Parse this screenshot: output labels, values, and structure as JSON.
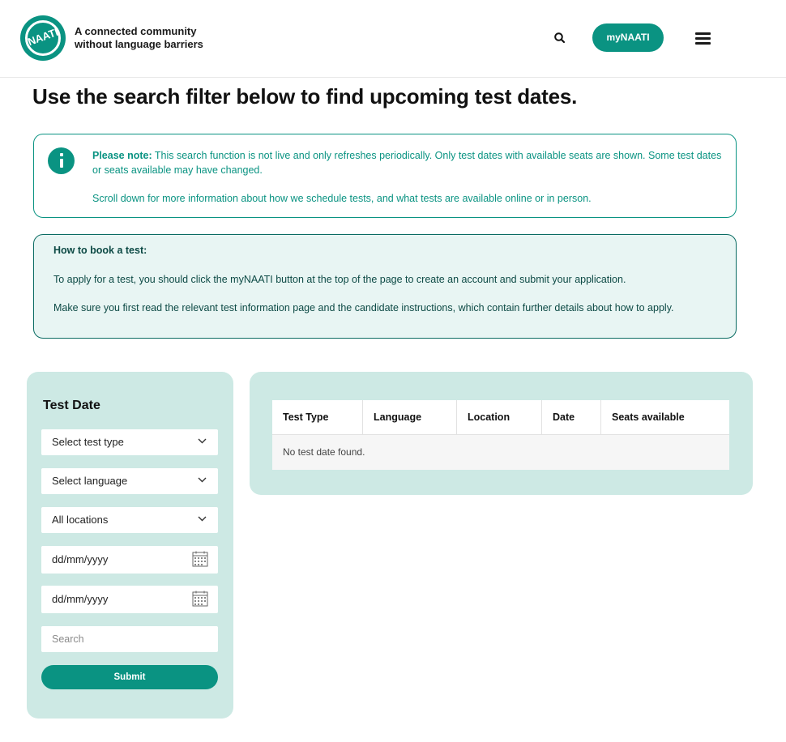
{
  "header": {
    "logo_text": "NAATI",
    "tagline_line1": "A connected community",
    "tagline_line2": "without language barriers",
    "mynaati_label": "myNAATI"
  },
  "page": {
    "title": "Use the search filter below to find upcoming test dates."
  },
  "note": {
    "label": "Please note:",
    "text": " This search function is not live and only refreshes periodically. Only test dates with available seats are shown. Some test dates or seats available may have changed.",
    "text2": "Scroll down for more information about how we schedule tests, and what tests are available online or in person."
  },
  "booking": {
    "title": "How to book a test:",
    "para1": "To apply for a test, you should click the myNAATI button at the top of the page to create an account and submit your application.",
    "para2": "Make sure you first read the relevant test information page and the candidate instructions, which contain further details about how to apply."
  },
  "filter": {
    "title": "Test Date",
    "test_type": "Select test type",
    "language": "Select language",
    "location": "All locations",
    "date_from": "dd/mm/yyyy",
    "date_to": "dd/mm/yyyy",
    "search_placeholder": "Search",
    "submit_label": "Submit"
  },
  "results": {
    "columns": [
      "Test Type",
      "Language",
      "Location",
      "Date",
      "Seats available"
    ],
    "empty_message": "No test date found."
  },
  "colors": {
    "brand": "#0a9382",
    "panel": "#cde9e4",
    "booking_bg": "#e8f5f3"
  },
  "icons": [
    "search-icon",
    "hamburger-menu-icon",
    "info-icon",
    "chevron-down-icon",
    "calendar-icon"
  ]
}
